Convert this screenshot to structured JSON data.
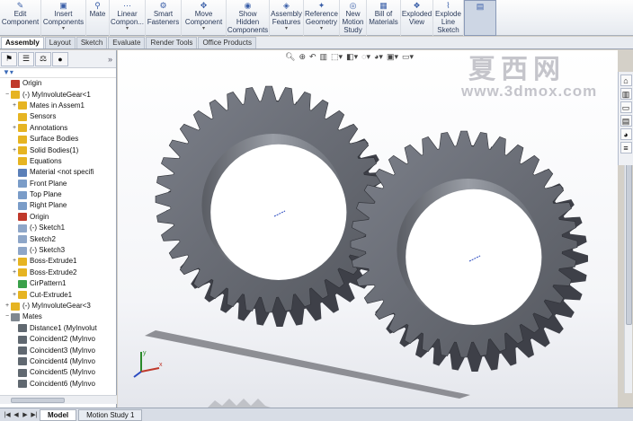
{
  "ribbon": {
    "buttons": [
      {
        "name": "edit-component-button",
        "icon": "edit-component-icon",
        "glyph": "✎",
        "label": "Edit\nComponent",
        "dropdown": false,
        "w": 46
      },
      {
        "name": "insert-components-button",
        "icon": "insert-components-icon",
        "glyph": "▣",
        "label": "Insert\nComponents",
        "dropdown": true,
        "w": 50
      },
      {
        "name": "mate-button",
        "icon": "mate-icon",
        "glyph": "⚲",
        "label": "Mate",
        "dropdown": false,
        "w": 26
      },
      {
        "name": "linear-component-pattern-button",
        "icon": "linear-pattern-icon",
        "glyph": "⋯",
        "label": "Linear\nCompon...",
        "dropdown": true,
        "w": 40
      },
      {
        "name": "smart-fasteners-button",
        "icon": "smart-fasteners-icon",
        "glyph": "⚙",
        "label": "Smart\nFasteners",
        "dropdown": false,
        "w": 40
      },
      {
        "name": "move-component-button",
        "icon": "move-component-icon",
        "glyph": "✥",
        "label": "Move\nComponent",
        "dropdown": true,
        "w": 50
      },
      {
        "name": "show-hidden-components-button",
        "icon": "show-hidden-icon",
        "glyph": "◉",
        "label": "Show\nHidden\nComponents",
        "dropdown": false,
        "w": 48
      },
      {
        "name": "assembly-features-button",
        "icon": "assembly-features-icon",
        "glyph": "◈",
        "label": "Assembly\nFeatures",
        "dropdown": true,
        "w": 38
      },
      {
        "name": "reference-geometry-button",
        "icon": "reference-geometry-icon",
        "glyph": "✦",
        "label": "Reference\nGeometry",
        "dropdown": true,
        "w": 40
      },
      {
        "name": "new-motion-study-button",
        "icon": "new-motion-study-icon",
        "glyph": "◎",
        "label": "New\nMotion\nStudy",
        "dropdown": false,
        "w": 30
      },
      {
        "name": "bill-of-materials-button",
        "icon": "bill-of-materials-icon",
        "glyph": "▦",
        "label": "Bill of\nMaterials",
        "dropdown": false,
        "w": 38
      },
      {
        "name": "exploded-view-button",
        "icon": "exploded-view-icon",
        "glyph": "❖",
        "label": "Exploded\nView",
        "dropdown": false,
        "w": 36
      },
      {
        "name": "explode-line-sketch-button",
        "icon": "explode-line-sketch-icon",
        "glyph": "⌇",
        "label": "Explode\nLine\nSketch",
        "dropdown": false,
        "w": 34
      },
      {
        "name": "instant3d-button",
        "icon": "instant3d-icon",
        "glyph": "▤",
        "label": "",
        "dropdown": false,
        "w": 36
      }
    ]
  },
  "tabs": [
    "Assembly",
    "Layout",
    "Sketch",
    "Evaluate",
    "Render Tools",
    "Office Products"
  ],
  "watermark": {
    "cn": "夏西网",
    "url": "www.3dmox.com"
  },
  "tree": [
    {
      "indent": 0,
      "exp": "",
      "icon": "origin-icon",
      "color": "#c0392b",
      "label": "Origin"
    },
    {
      "indent": 0,
      "exp": "−",
      "icon": "part-icon",
      "color": "#e6b422",
      "label": "(-) MyInvoluteGear<1"
    },
    {
      "indent": 1,
      "exp": "+",
      "icon": "mates-folder-icon",
      "color": "#e6b422",
      "label": "Mates in Assem1"
    },
    {
      "indent": 1,
      "exp": "",
      "icon": "sensors-icon",
      "color": "#e6b422",
      "label": "Sensors"
    },
    {
      "indent": 1,
      "exp": "+",
      "icon": "annotations-icon",
      "color": "#e6b422",
      "label": "Annotations"
    },
    {
      "indent": 1,
      "exp": "",
      "icon": "surface-bodies-icon",
      "color": "#e6b422",
      "label": "Surface Bodies"
    },
    {
      "indent": 1,
      "exp": "+",
      "icon": "solid-bodies-icon",
      "color": "#e6b422",
      "label": "Solid Bodies(1)"
    },
    {
      "indent": 1,
      "exp": "",
      "icon": "equations-icon",
      "color": "#e6b422",
      "label": "Equations"
    },
    {
      "indent": 1,
      "exp": "",
      "icon": "material-icon",
      "color": "#5a7fb8",
      "label": "Material <not specifi"
    },
    {
      "indent": 1,
      "exp": "",
      "icon": "plane-icon",
      "color": "#7a9cc8",
      "label": "Front Plane"
    },
    {
      "indent": 1,
      "exp": "",
      "icon": "plane-icon",
      "color": "#7a9cc8",
      "label": "Top Plane"
    },
    {
      "indent": 1,
      "exp": "",
      "icon": "plane-icon",
      "color": "#7a9cc8",
      "label": "Right Plane"
    },
    {
      "indent": 1,
      "exp": "",
      "icon": "origin-icon",
      "color": "#c0392b",
      "label": "Origin"
    },
    {
      "indent": 1,
      "exp": "",
      "icon": "sketch-icon",
      "color": "#8ea6c8",
      "label": "(-) Sketch1"
    },
    {
      "indent": 1,
      "exp": "",
      "icon": "sketch-icon",
      "color": "#8ea6c8",
      "label": "Sketch2"
    },
    {
      "indent": 1,
      "exp": "",
      "icon": "sketch-icon",
      "color": "#8ea6c8",
      "label": "(-) Sketch3"
    },
    {
      "indent": 1,
      "exp": "+",
      "icon": "boss-extrude-icon",
      "color": "#e6b422",
      "label": "Boss-Extrude1"
    },
    {
      "indent": 1,
      "exp": "+",
      "icon": "boss-extrude-icon",
      "color": "#e6b422",
      "label": "Boss-Extrude2"
    },
    {
      "indent": 1,
      "exp": "",
      "icon": "circular-pattern-icon",
      "color": "#3aa04a",
      "label": "CirPattern1"
    },
    {
      "indent": 1,
      "exp": "+",
      "icon": "cut-extrude-icon",
      "color": "#e6b422",
      "label": "Cut-Extrude1"
    },
    {
      "indent": 0,
      "exp": "+",
      "icon": "part-icon",
      "color": "#e6b422",
      "label": "(-) MyInvoluteGear<3"
    },
    {
      "indent": 0,
      "exp": "−",
      "icon": "mates-icon",
      "color": "#808890",
      "label": "Mates"
    },
    {
      "indent": 1,
      "exp": "",
      "icon": "distance-mate-icon",
      "color": "#606870",
      "label": "Distance1 (MyInvolut"
    },
    {
      "indent": 1,
      "exp": "",
      "icon": "coincident-mate-icon",
      "color": "#606870",
      "label": "Coincident2 (MyInvo"
    },
    {
      "indent": 1,
      "exp": "",
      "icon": "coincident-mate-icon",
      "color": "#606870",
      "label": "Coincident3 (MyInvo"
    },
    {
      "indent": 1,
      "exp": "",
      "icon": "coincident-mate-icon",
      "color": "#606870",
      "label": "Coincident4 (MyInvo"
    },
    {
      "indent": 1,
      "exp": "",
      "icon": "coincident-mate-icon",
      "color": "#606870",
      "label": "Coincident5 (MyInvo"
    },
    {
      "indent": 1,
      "exp": "",
      "icon": "coincident-mate-icon",
      "color": "#606870",
      "label": "Coincident6 (MyInvo"
    }
  ],
  "bottom_tabs": [
    "Model",
    "Motion Study 1"
  ],
  "colors": {
    "gear": "#6a6e78",
    "gear_dark": "#3e4048",
    "gear_light": "#9ca0a8"
  }
}
